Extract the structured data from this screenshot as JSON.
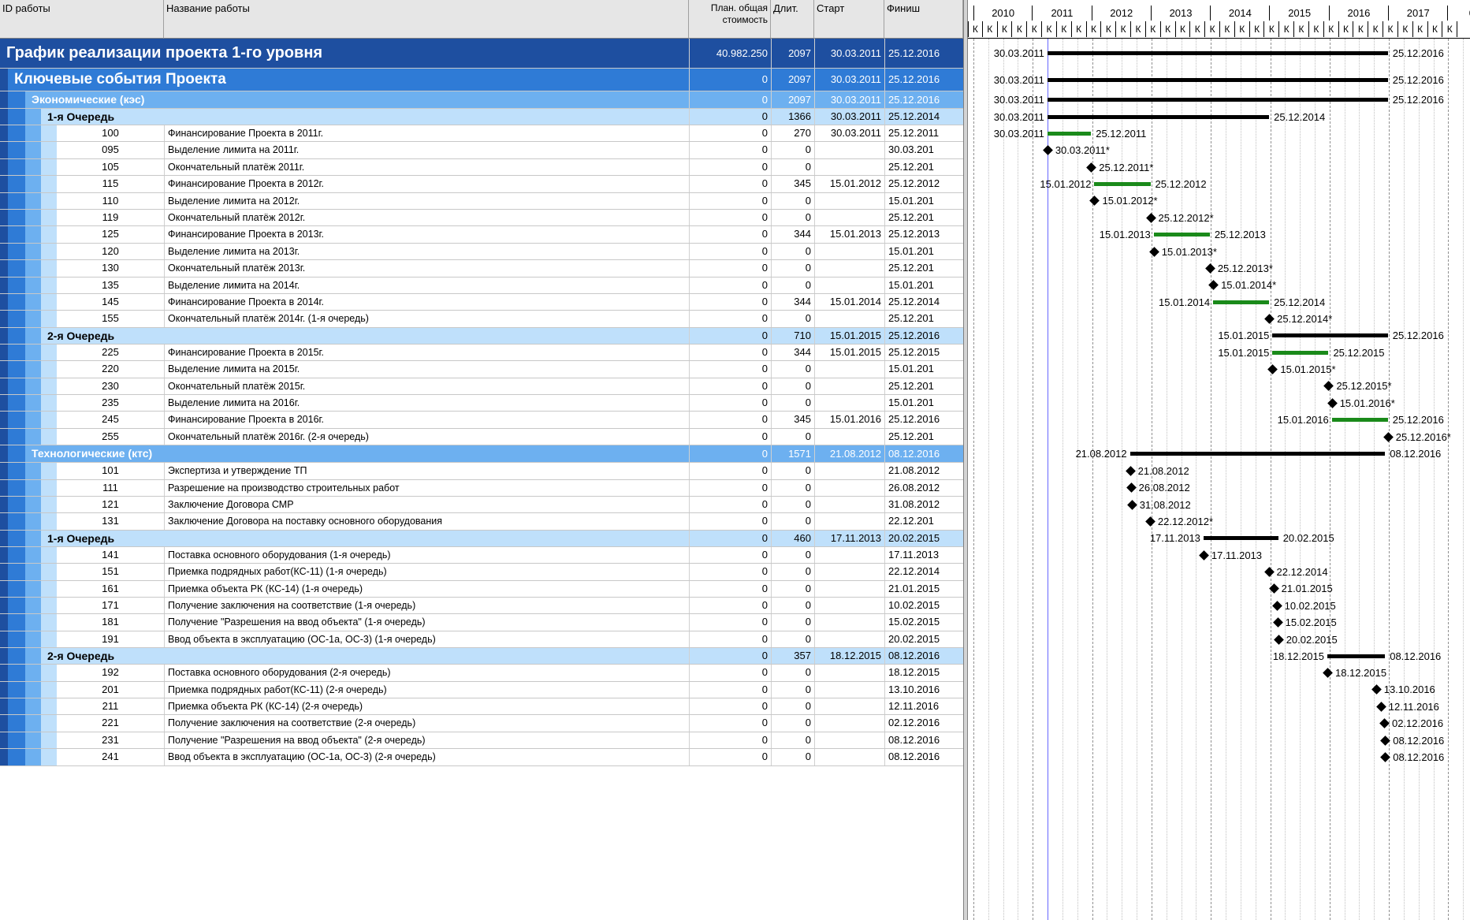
{
  "header": {
    "col_id": "ID работы",
    "col_name": "Название работы",
    "col_cost": "План. общая стоимость",
    "col_dur": "Длит.",
    "col_start": "Старт",
    "col_finish": "Финиш",
    "years": [
      "2010",
      "2011",
      "2012",
      "2013",
      "2014",
      "2015",
      "2016",
      "2017",
      "018"
    ],
    "quarter_label": "К"
  },
  "colors": {
    "level1": "#1e4fa0",
    "level2": "#2f7bd6",
    "level3": "#6db0f0",
    "level4": "#bfe0fb",
    "task_bar": "#1a8a1a",
    "summary_bar": "#000000",
    "data_date_line": "#6666ff"
  },
  "rows": [
    {
      "level": 1,
      "id": "",
      "name": "График реализации проекта 1-го уровня",
      "cost": "40.982.250",
      "dur": "2097",
      "start": "30.03.2011",
      "finish": "25.12.2016",
      "kind": "summary",
      "lbl_start": "30.03.2011",
      "lbl_finish": "25.12.2016"
    },
    {
      "level": 2,
      "id": "",
      "name": "Ключевые события Проекта",
      "cost": "0",
      "dur": "2097",
      "start": "30.03.2011",
      "finish": "25.12.2016",
      "kind": "summary",
      "lbl_start": "30.03.2011",
      "lbl_finish": "25.12.2016"
    },
    {
      "level": 3,
      "id": "",
      "name": "Экономические (кэс)",
      "cost": "0",
      "dur": "2097",
      "start": "30.03.2011",
      "finish": "25.12.2016",
      "kind": "summary",
      "lbl_start": "30.03.2011",
      "lbl_finish": "25.12.2016"
    },
    {
      "level": 4,
      "id": "",
      "name": "1-я Очередь",
      "cost": "0",
      "dur": "1366",
      "start": "30.03.2011",
      "finish": "25.12.2014",
      "kind": "summary",
      "lbl_start": "30.03.2011",
      "lbl_finish": "25.12.2014"
    },
    {
      "level": 5,
      "id": "100",
      "name": "Финансирование Проекта в 2011г.",
      "cost": "0",
      "dur": "270",
      "start": "30.03.2011",
      "finish": "25.12.2011",
      "kind": "task",
      "lbl_start": "30.03.2011",
      "lbl_finish": "25.12.2011"
    },
    {
      "level": 5,
      "id": "095",
      "name": "Выделение лимита на 2011г.",
      "cost": "0",
      "dur": "0",
      "start": "",
      "finish": "30.03.201",
      "kind": "milestone",
      "lbl_finish": "30.03.2011*"
    },
    {
      "level": 5,
      "id": "105",
      "name": "Окончательный платёж 2011г.",
      "cost": "0",
      "dur": "0",
      "start": "",
      "finish": "25.12.201",
      "kind": "milestone",
      "lbl_finish": "25.12.2011*"
    },
    {
      "level": 5,
      "id": "115",
      "name": "Финансирование Проекта в 2012г.",
      "cost": "0",
      "dur": "345",
      "start": "15.01.2012",
      "finish": "25.12.2012",
      "kind": "task",
      "lbl_start": "15.01.2012",
      "lbl_finish": "25.12.2012"
    },
    {
      "level": 5,
      "id": "110",
      "name": "Выделение лимита на 2012г.",
      "cost": "0",
      "dur": "0",
      "start": "",
      "finish": "15.01.201",
      "kind": "milestone",
      "lbl_finish": "15.01.2012*"
    },
    {
      "level": 5,
      "id": "119",
      "name": "Окончательный платёж 2012г.",
      "cost": "0",
      "dur": "0",
      "start": "",
      "finish": "25.12.201",
      "kind": "milestone",
      "lbl_finish": "25.12.2012*"
    },
    {
      "level": 5,
      "id": "125",
      "name": "Финансирование Проекта в 2013г.",
      "cost": "0",
      "dur": "344",
      "start": "15.01.2013",
      "finish": "25.12.2013",
      "kind": "task",
      "lbl_start": "15.01.2013",
      "lbl_finish": "25.12.2013"
    },
    {
      "level": 5,
      "id": "120",
      "name": "Выделение лимита на 2013г.",
      "cost": "0",
      "dur": "0",
      "start": "",
      "finish": "15.01.201",
      "kind": "milestone",
      "lbl_finish": "15.01.2013*"
    },
    {
      "level": 5,
      "id": "130",
      "name": "Окончательный платёж 2013г.",
      "cost": "0",
      "dur": "0",
      "start": "",
      "finish": "25.12.201",
      "kind": "milestone",
      "lbl_finish": "25.12.2013*"
    },
    {
      "level": 5,
      "id": "135",
      "name": "Выделение лимита на 2014г.",
      "cost": "0",
      "dur": "0",
      "start": "",
      "finish": "15.01.201",
      "kind": "milestone",
      "lbl_finish": "15.01.2014*"
    },
    {
      "level": 5,
      "id": "145",
      "name": "Финансирование Проекта в 2014г.",
      "cost": "0",
      "dur": "344",
      "start": "15.01.2014",
      "finish": "25.12.2014",
      "kind": "task",
      "lbl_start": "15.01.2014",
      "lbl_finish": "25.12.2014"
    },
    {
      "level": 5,
      "id": "155",
      "name": "Окончательный платёж 2014г. (1-я очередь)",
      "cost": "0",
      "dur": "0",
      "start": "",
      "finish": "25.12.201",
      "kind": "milestone",
      "lbl_finish": "25.12.2014*"
    },
    {
      "level": 4,
      "id": "",
      "name": "2-я Очередь",
      "cost": "0",
      "dur": "710",
      "start": "15.01.2015",
      "finish": "25.12.2016",
      "kind": "summary",
      "lbl_start": "15.01.2015",
      "lbl_finish": "25.12.2016"
    },
    {
      "level": 5,
      "id": "225",
      "name": "Финансирование Проекта в 2015г.",
      "cost": "0",
      "dur": "344",
      "start": "15.01.2015",
      "finish": "25.12.2015",
      "kind": "task",
      "lbl_start": "15.01.2015",
      "lbl_finish": "25.12.2015"
    },
    {
      "level": 5,
      "id": "220",
      "name": "Выделение лимита на 2015г.",
      "cost": "0",
      "dur": "0",
      "start": "",
      "finish": "15.01.201",
      "kind": "milestone",
      "lbl_finish": "15.01.2015*"
    },
    {
      "level": 5,
      "id": "230",
      "name": "Окончательный платёж 2015г.",
      "cost": "0",
      "dur": "0",
      "start": "",
      "finish": "25.12.201",
      "kind": "milestone",
      "lbl_finish": "25.12.2015*"
    },
    {
      "level": 5,
      "id": "235",
      "name": "Выделение лимита на 2016г.",
      "cost": "0",
      "dur": "0",
      "start": "",
      "finish": "15.01.201",
      "kind": "milestone",
      "lbl_finish": "15.01.2016*"
    },
    {
      "level": 5,
      "id": "245",
      "name": "Финансирование Проекта в 2016г.",
      "cost": "0",
      "dur": "345",
      "start": "15.01.2016",
      "finish": "25.12.2016",
      "kind": "task",
      "lbl_start": "15.01.2016",
      "lbl_finish": "25.12.2016"
    },
    {
      "level": 5,
      "id": "255",
      "name": "Окончательный платёж 2016г. (2-я очередь)",
      "cost": "0",
      "dur": "0",
      "start": "",
      "finish": "25.12.201",
      "kind": "milestone",
      "lbl_finish": "25.12.2016*"
    },
    {
      "level": 3,
      "id": "",
      "name": "Технологические (ктс)",
      "cost": "0",
      "dur": "1571",
      "start": "21.08.2012",
      "finish": "08.12.2016",
      "kind": "summary",
      "lbl_start": "21.08.2012",
      "lbl_finish": "08.12.2016"
    },
    {
      "level": 5,
      "id": "101",
      "name": "Экспертиза и утверждение ТП",
      "cost": "0",
      "dur": "0",
      "start": "",
      "finish": "21.08.2012",
      "kind": "milestone",
      "lbl_finish": "21.08.2012"
    },
    {
      "level": 5,
      "id": "111",
      "name": "Разрешение на производство строительных работ",
      "cost": "0",
      "dur": "0",
      "start": "",
      "finish": "26.08.2012",
      "kind": "milestone",
      "lbl_finish": "26.08.2012"
    },
    {
      "level": 5,
      "id": "121",
      "name": "Заключение Договора СМР",
      "cost": "0",
      "dur": "0",
      "start": "",
      "finish": "31.08.2012",
      "kind": "milestone",
      "lbl_finish": "31.08.2012"
    },
    {
      "level": 5,
      "id": "131",
      "name": "Заключение Договора на поставку основного оборудования",
      "cost": "0",
      "dur": "0",
      "start": "",
      "finish": "22.12.201",
      "kind": "milestone",
      "lbl_finish": "22.12.2012*"
    },
    {
      "level": 4,
      "id": "",
      "name": "1-я Очередь",
      "cost": "0",
      "dur": "460",
      "start": "17.11.2013",
      "finish": "20.02.2015",
      "kind": "summary",
      "lbl_start": "17.11.2013",
      "lbl_finish": "20.02.2015"
    },
    {
      "level": 5,
      "id": "141",
      "name": "Поставка основного оборудования (1-я очередь)",
      "cost": "0",
      "dur": "0",
      "start": "",
      "finish": "17.11.2013",
      "kind": "milestone",
      "lbl_finish": "17.11.2013"
    },
    {
      "level": 5,
      "id": "151",
      "name": "Приемка подрядных работ(КС-11) (1-я очередь)",
      "cost": "0",
      "dur": "0",
      "start": "",
      "finish": "22.12.2014",
      "kind": "milestone",
      "lbl_finish": "22.12.2014"
    },
    {
      "level": 5,
      "id": "161",
      "name": "Приемка объекта РК (КС-14) (1-я очередь)",
      "cost": "0",
      "dur": "0",
      "start": "",
      "finish": "21.01.2015",
      "kind": "milestone",
      "lbl_finish": "21.01.2015"
    },
    {
      "level": 5,
      "id": "171",
      "name": "Получение заключения на соответствие (1-я очередь)",
      "cost": "0",
      "dur": "0",
      "start": "",
      "finish": "10.02.2015",
      "kind": "milestone",
      "lbl_finish": "10.02.2015"
    },
    {
      "level": 5,
      "id": "181",
      "name": "Получение \"Разрешения на ввод объекта\" (1-я очередь)",
      "cost": "0",
      "dur": "0",
      "start": "",
      "finish": "15.02.2015",
      "kind": "milestone",
      "lbl_finish": "15.02.2015"
    },
    {
      "level": 5,
      "id": "191",
      "name": "Ввод объекта в эксплуатацию (ОС-1а, ОС-3) (1-я очередь)",
      "cost": "0",
      "dur": "0",
      "start": "",
      "finish": "20.02.2015",
      "kind": "milestone",
      "lbl_finish": "20.02.2015"
    },
    {
      "level": 4,
      "id": "",
      "name": "2-я Очередь",
      "cost": "0",
      "dur": "357",
      "start": "18.12.2015",
      "finish": "08.12.2016",
      "kind": "summary",
      "lbl_start": "18.12.2015",
      "lbl_finish": "08.12.2016"
    },
    {
      "level": 5,
      "id": "192",
      "name": "Поставка основного оборудования (2-я очередь)",
      "cost": "0",
      "dur": "0",
      "start": "",
      "finish": "18.12.2015",
      "kind": "milestone",
      "lbl_finish": "18.12.2015"
    },
    {
      "level": 5,
      "id": "201",
      "name": "Приемка подрядных работ(КС-11) (2-я очередь)",
      "cost": "0",
      "dur": "0",
      "start": "",
      "finish": "13.10.2016",
      "kind": "milestone",
      "lbl_finish": "13.10.2016"
    },
    {
      "level": 5,
      "id": "211",
      "name": "Приемка объекта РК (КС-14) (2-я очередь)",
      "cost": "0",
      "dur": "0",
      "start": "",
      "finish": "12.11.2016",
      "kind": "milestone",
      "lbl_finish": "12.11.2016"
    },
    {
      "level": 5,
      "id": "221",
      "name": "Получение заключения на соответствие (2-я очередь)",
      "cost": "0",
      "dur": "0",
      "start": "",
      "finish": "02.12.2016",
      "kind": "milestone",
      "lbl_finish": "02.12.2016"
    },
    {
      "level": 5,
      "id": "231",
      "name": "Получение \"Разрешения на ввод объекта\" (2-я очередь)",
      "cost": "0",
      "dur": "0",
      "start": "",
      "finish": "08.12.2016",
      "kind": "milestone",
      "lbl_finish": "08.12.2016"
    },
    {
      "level": 5,
      "id": "241",
      "name": "Ввод объекта в эксплуатацию (ОС-1а, ОС-3) (2-я очередь)",
      "cost": "0",
      "dur": "0",
      "start": "",
      "finish": "08.12.2016",
      "kind": "milestone",
      "lbl_finish": "08.12.2016"
    }
  ]
}
